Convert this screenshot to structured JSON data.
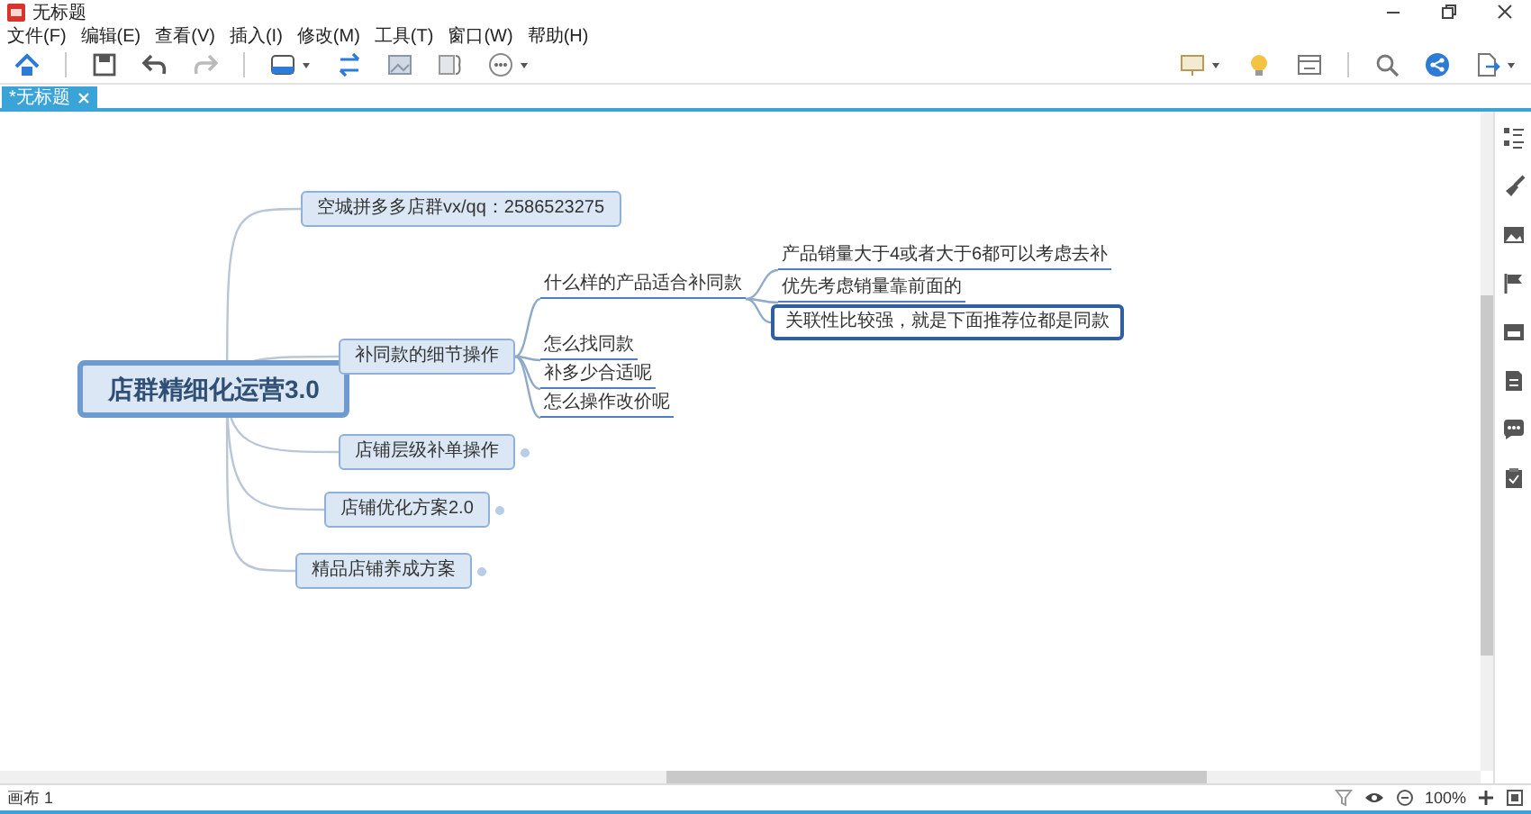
{
  "window": {
    "title": "无标题"
  },
  "menu": [
    "文件(F)",
    "编辑(E)",
    "查看(V)",
    "插入(I)",
    "修改(M)",
    "工具(T)",
    "窗口(W)",
    "帮助(H)"
  ],
  "tabs": [
    {
      "label": "*无标题",
      "selected": true
    }
  ],
  "mindmap": {
    "text": "店群精细化运营3.0",
    "selected": false,
    "children": [
      {
        "text": "空城拼多多店群vx/qq：2586523275",
        "selected": false
      },
      {
        "text": "补同款的细节操作",
        "selected": false,
        "children": [
          {
            "text": "什么样的产品适合补同款",
            "selected": false,
            "children": [
              {
                "text": "产品销量大于4或者大于6都可以考虑去补",
                "selected": false
              },
              {
                "text": "优先考虑销量靠前面的",
                "selected": false
              },
              {
                "text": "关联性比较强，就是下面推荐位都是同款",
                "selected": true
              }
            ]
          },
          {
            "text": "怎么找同款",
            "selected": false
          },
          {
            "text": "补多少合适呢",
            "selected": false
          },
          {
            "text": "怎么操作改价呢",
            "selected": false
          }
        ]
      },
      {
        "text": "店铺层级补单操作",
        "selected": false,
        "collapsed": true
      },
      {
        "text": "店铺优化方案2.0",
        "selected": false,
        "collapsed": true
      },
      {
        "text": "精品店铺养成方案",
        "selected": false,
        "collapsed": true
      }
    ]
  },
  "status_bar": {
    "canvas": "画布 1",
    "zoom": "100%"
  }
}
